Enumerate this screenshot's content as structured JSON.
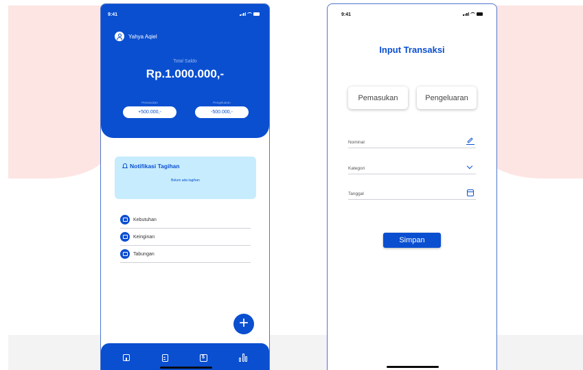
{
  "phone1": {
    "status_time": "9:41",
    "user_name": "Yahya Aqiel",
    "saldo_label": "Total Saldo",
    "saldo_value": "Rp.1.000.000,-",
    "income_label": "Pemasukan",
    "income_value": "+500.000,-",
    "expense_label": "Pengeluaran",
    "expense_value": "-500.000,-",
    "notif_title": "Notifikasi Tagihan",
    "notif_empty": "Belum ada tagihan",
    "categories": [
      {
        "label": "Kebutuhan",
        "icon": "basket-icon"
      },
      {
        "label": "Keinginan",
        "icon": "gift-icon"
      },
      {
        "label": "Tabungan",
        "icon": "coins-icon"
      }
    ],
    "fab_label": "+",
    "nav": [
      "home-icon",
      "clipboard-icon",
      "dollar-icon",
      "chart-bars-icon"
    ],
    "colors": {
      "primary": "#0a4fd0",
      "notif_bg": "#c7ecfd"
    }
  },
  "phone2": {
    "status_time": "9:41",
    "title": "Input Transaksi",
    "type_income": "Pemasukan",
    "type_expense": "Pengeluaran",
    "fields": {
      "nominal_placeholder": "Nominal",
      "kategori_placeholder": "Kategori",
      "tanggal_placeholder": "Tanggal"
    },
    "save_label": "Simpan"
  }
}
